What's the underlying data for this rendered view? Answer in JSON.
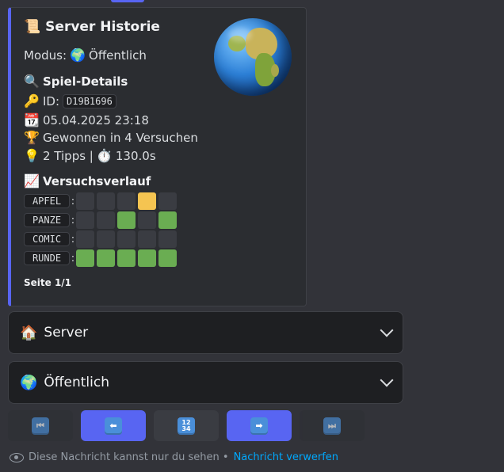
{
  "embed": {
    "title": "Server Historie",
    "title_emoji": "📜",
    "modus_label": "Modus:",
    "modus_emoji": "🌍",
    "modus_value": "Öffentlich",
    "details_emoji": "🔍",
    "details_heading": "Spiel-Details",
    "id_emoji": "🔑",
    "id_label": "ID:",
    "id_value": "D19B1696",
    "date_emoji": "📆",
    "date_value": "05.04.2025 23:18",
    "result_emoji": "🏆",
    "result_value": "Gewonnen in 4 Versuchen",
    "tips_emoji": "💡",
    "tips_value": "2 Tipps |",
    "time_emoji": "⏱️",
    "time_value": "130.0s",
    "history_emoji": "📈",
    "history_heading": "Versuchsverlauf",
    "guesses": [
      {
        "word": "APFEL",
        "cells": [
          "empty",
          "empty",
          "empty",
          "yellow",
          "empty"
        ]
      },
      {
        "word": "PANZE",
        "cells": [
          "empty",
          "empty",
          "green",
          "empty",
          "green"
        ]
      },
      {
        "word": "COMIC",
        "cells": [
          "empty",
          "empty",
          "empty",
          "empty",
          "empty"
        ]
      },
      {
        "word": "RUNDE",
        "cells": [
          "green",
          "green",
          "green",
          "green",
          "green"
        ]
      }
    ],
    "page_label": "Seite 1/1"
  },
  "select_server": {
    "emoji": "🏠",
    "label": "Server"
  },
  "select_public": {
    "emoji": "🌍",
    "label": "Öffentlich"
  },
  "buttons": {
    "first_icon": "⏮",
    "prev_icon": "⬅",
    "page_icon_top": "12",
    "page_icon_bottom": "34",
    "next_icon": "➡",
    "last_icon": "⏭"
  },
  "footer": {
    "text": "Diese Nachricht kannst nur du sehen •",
    "link": "Nachricht verwerfen"
  },
  "colors": {
    "accent": "#5865f2",
    "green": "#6aad52",
    "yellow": "#f5c451",
    "link": "#00a8fc"
  }
}
